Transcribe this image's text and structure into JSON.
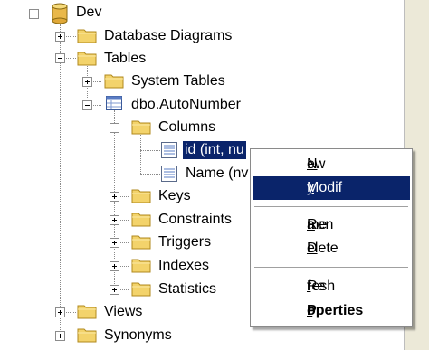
{
  "tree": {
    "root": {
      "label": "Dev"
    },
    "database_diagrams": {
      "label": "Database Diagrams"
    },
    "tables": {
      "label": "Tables"
    },
    "system_tables": {
      "label": "System Tables"
    },
    "auto_number": {
      "label": "dbo.AutoNumber"
    },
    "columns": {
      "label": "Columns"
    },
    "column_id": {
      "label": "id (int, nu"
    },
    "column_name": {
      "label": "Name (nv"
    },
    "keys": {
      "label": "Keys"
    },
    "constraints": {
      "label": "Constraints"
    },
    "triggers": {
      "label": "Triggers"
    },
    "indexes": {
      "label": "Indexes"
    },
    "statistics": {
      "label": "Statistics"
    },
    "views": {
      "label": "Views"
    },
    "synonyms": {
      "label": "Synonyms"
    }
  },
  "context_menu": {
    "new_column": {
      "before": "",
      "accel": "N",
      "after": "ew Column..."
    },
    "modify": {
      "before": "Modif",
      "accel": "y",
      "after": ""
    },
    "rename": {
      "before": "Ren",
      "accel": "a",
      "after": "me"
    },
    "delete": {
      "before": "",
      "accel": "D",
      "after": "elete"
    },
    "refresh": {
      "before": "Re",
      "accel": "f",
      "after": "resh"
    },
    "properties": {
      "before": "P",
      "accel": "r",
      "after": "operties"
    }
  },
  "icons": {
    "root": "database-cylinder-icon",
    "folder": "folder-icon",
    "table": "table-icon",
    "column": "column-icon"
  },
  "colors": {
    "selection": "#0a246a",
    "folder": "#f3d36b",
    "database": "#e9b84a"
  }
}
